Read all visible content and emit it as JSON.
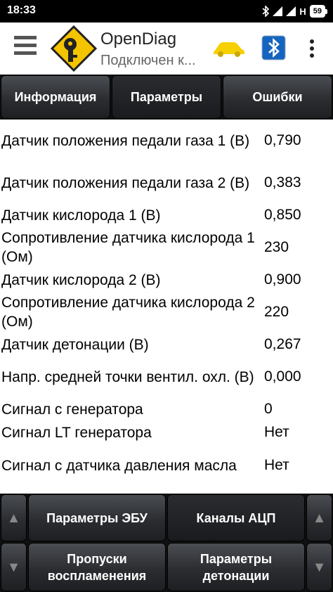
{
  "status": {
    "time": "18:33",
    "network": "H",
    "battery": "59"
  },
  "app": {
    "title": "OpenDiag",
    "subtitle": "Подключен к..."
  },
  "tabs": [
    {
      "label": "Информация",
      "active": false
    },
    {
      "label": "Параметры",
      "active": true
    },
    {
      "label": "Ошибки",
      "active": false
    }
  ],
  "params": [
    {
      "name": "Датчик положения педали газа 1 (В)",
      "value": "0,790"
    },
    {
      "name": "Датчик положения педали газа 2 (В)",
      "value": "0,383"
    },
    {
      "name": "Датчик кислорода 1 (В)",
      "value": "0,850"
    },
    {
      "name": "Сопротивление датчика кислорода 1 (Ом)",
      "value": "230"
    },
    {
      "name": "Датчик кислорода 2 (В)",
      "value": "0,900"
    },
    {
      "name": "Сопротивление датчика кислорода 2 (Ом)",
      "value": "220"
    },
    {
      "name": "Датчик детонации (В)",
      "value": "0,267"
    },
    {
      "name": "Напр. средней точки вентил. охл. (В)",
      "value": "0,000"
    },
    {
      "name": "Сигнал с генератора",
      "value": "0"
    },
    {
      "name": "Сигнал LT генератора",
      "value": "Нет"
    },
    {
      "name": "Сигнал с датчика давления масла",
      "value": "Нет"
    }
  ],
  "bottom": {
    "up_arrow": "▲",
    "down_arrow": "▼",
    "ecu_params": "Параметры ЭБУ",
    "adc_channels": "Каналы АЦП",
    "misfires": "Пропуски воспламенения",
    "detonation_params": "Параметры детонации"
  },
  "colors": {
    "logo_yellow": "#f5c400",
    "car_yellow": "#f7d000",
    "bt_blue": "#1565c0"
  }
}
